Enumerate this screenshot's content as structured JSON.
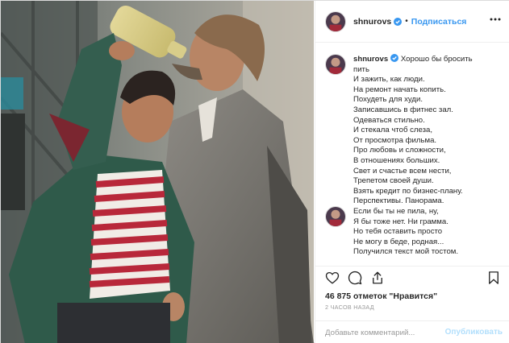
{
  "post": {
    "photo_alt": "",
    "author": {
      "username": "shnurovs",
      "verified": true,
      "follow_label": "Подписаться",
      "separator": "•"
    },
    "caption": {
      "username": "shnurovs",
      "lines": [
        "Хорошо бы бросить",
        "пить",
        "И зажить, как люди.",
        "На ремонт начать копить.",
        "Похудеть для худи.",
        "Записавшись в фитнес зал.",
        "Одеваться стильно.",
        "И стекала чтоб слеза,",
        "От просмотра фильма.",
        "Про любовь и сложности,",
        "В отношениях больших.",
        "Свет и счастье всем нести,",
        "Трепетом своей души.",
        "Взять кредит по бизнес-плану.",
        "Перспективы. Панорама.",
        "Если бы ты не пила, ну,",
        "Я бы тоже нет. Ни грамма.",
        "Но тебя оставить просто",
        "Не могу в беде, родная...",
        "Получился текст мой тостом."
      ]
    },
    "likes_text": "46 875 отметок \"Нравится\"",
    "timestamp": "2 ЧАСОВ НАЗАД",
    "comment": {
      "placeholder": "Добавьте комментарий...",
      "value": "",
      "publish_label": "Опубликовать"
    },
    "icons": {
      "like": "heart-icon",
      "comment": "comment-icon",
      "share": "share-icon",
      "save": "bookmark-icon",
      "more": "more-icon"
    },
    "colors": {
      "link": "#3897f0",
      "publish_disabled": "#b2dffc",
      "text": "#262626",
      "muted": "#999999"
    }
  }
}
